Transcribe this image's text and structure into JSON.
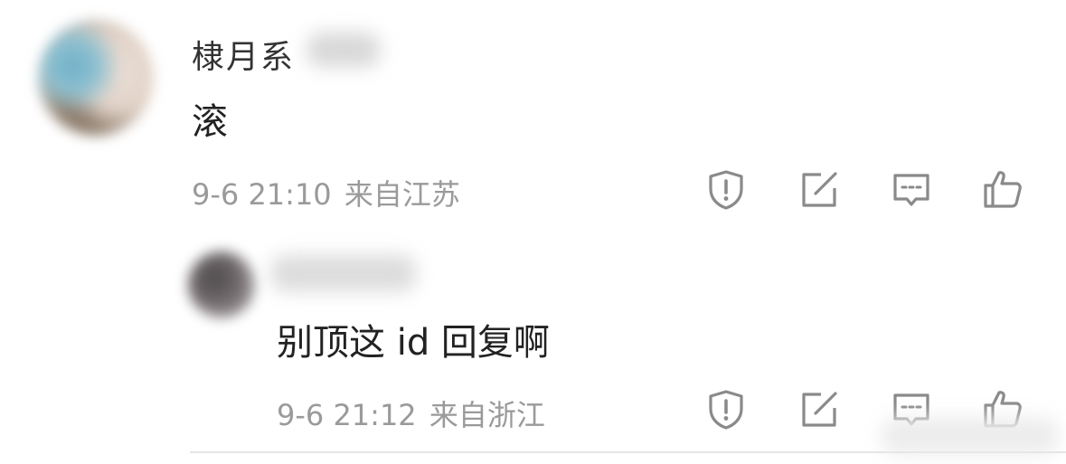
{
  "comment": {
    "username": "棣月系",
    "content": "滚",
    "date": "9-6",
    "time": "21:10",
    "location": "来自江苏"
  },
  "reply": {
    "username": "",
    "content": "别顶这 id 回复啊",
    "date": "9-6",
    "time": "21:12",
    "location": "来自浙江"
  },
  "actions": [
    "report-icon",
    "share-icon",
    "comment-icon",
    "like-icon"
  ],
  "colors": {
    "text": "#222222",
    "username": "#333333",
    "meta": "#9a9a9a",
    "icon": "#8a8a8a",
    "divider": "#e6e6e6"
  }
}
